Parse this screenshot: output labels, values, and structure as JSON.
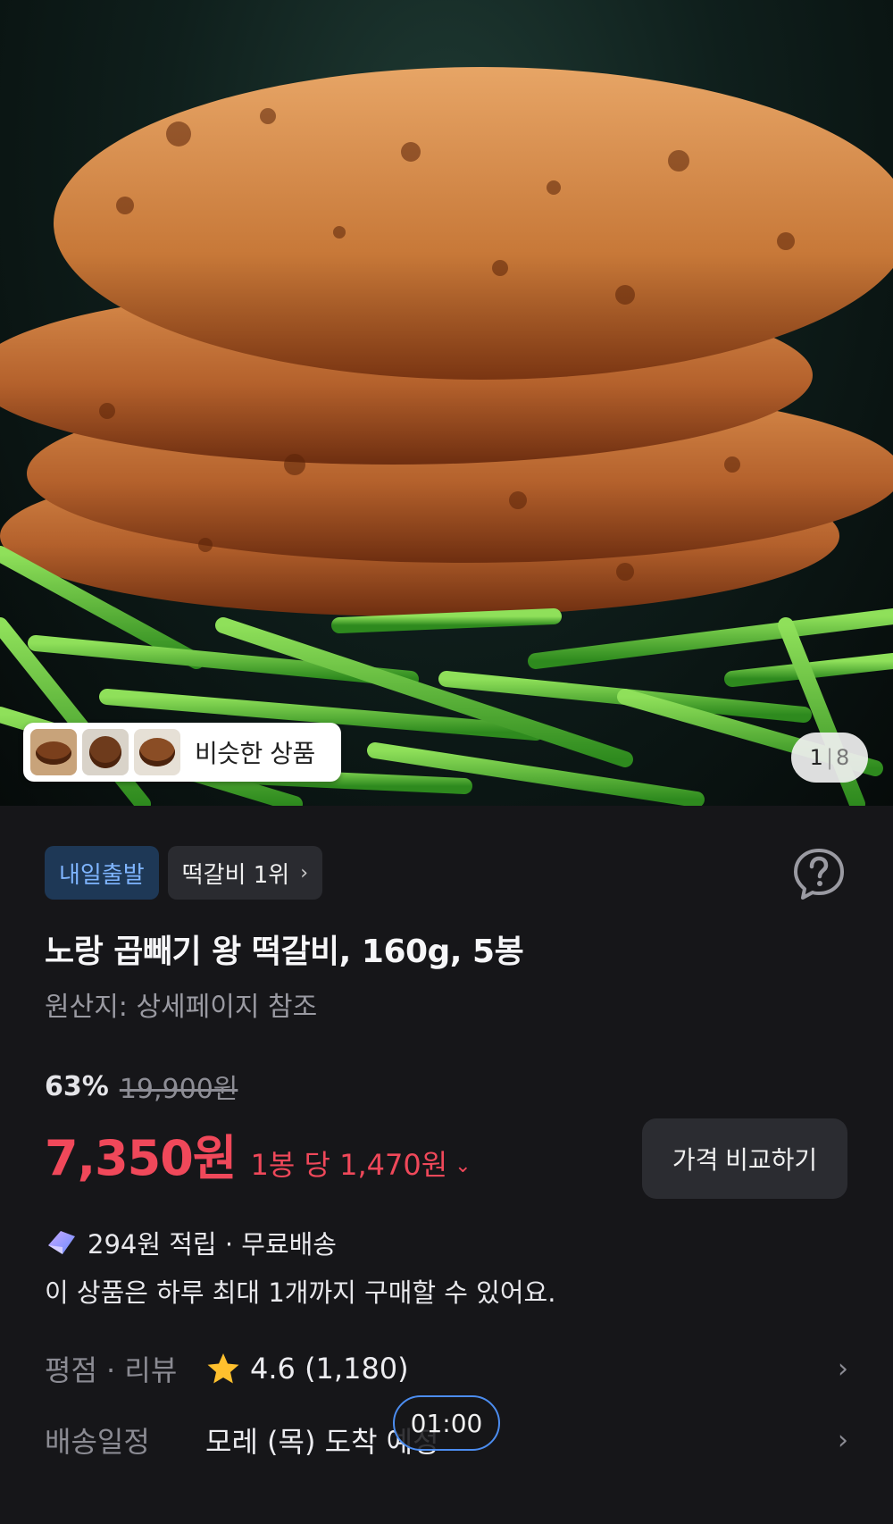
{
  "gallery": {
    "similar_label": "비슷한 상품",
    "page_current": "1",
    "page_total": "8"
  },
  "badges": {
    "depart": "내일출발",
    "rank": "떡갈비 1위",
    "rank_chevron": "›"
  },
  "icons": {
    "help": "question-circle-icon",
    "reward": "cashback-icon",
    "star": "star-icon",
    "rank_chevron": "chevron-right-icon"
  },
  "product": {
    "title": "노랑 곱빼기 왕 떡갈비, 160g, 5봉",
    "origin": "원산지: 상세페이지 참조"
  },
  "price": {
    "discount_rate": "63%",
    "original": "19,900원",
    "sale": "7,350원",
    "unit": "1봉 당 1,470원",
    "unit_chevron": "⌄",
    "compare_button": "가격 비교하기"
  },
  "benefits": {
    "reward": "294원 적립 · 무료배송",
    "limit": "이 상품은 하루 최대 1개까지 구매할 수 있어요."
  },
  "rating_row": {
    "label": "평점 · 리뷰",
    "value": "4.6 (1,180)",
    "chevron": "›"
  },
  "delivery_row": {
    "label": "배송일정",
    "value": "모레 (목) 도착 예정",
    "chevron": "›"
  },
  "timer": "01:00",
  "colors": {
    "accent_red": "#f0485a",
    "depart_blue": "#7fb5ff",
    "timer_border": "#4c8df0",
    "star": "#ffc02e"
  }
}
